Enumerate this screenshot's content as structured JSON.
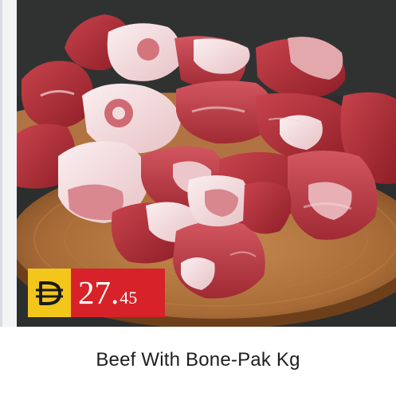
{
  "product": {
    "title": "Beef With Bone-Pak  Kg",
    "image_icon": "beef-with-bone-photo"
  },
  "price": {
    "currency_icon": "dirham-symbol-icon",
    "integer": "27.",
    "decimal": "45"
  },
  "colors": {
    "price_bg": "#d72229",
    "currency_bg": "#f3c61c",
    "photo_bg": "#2f3131",
    "board": "#a86b37"
  }
}
